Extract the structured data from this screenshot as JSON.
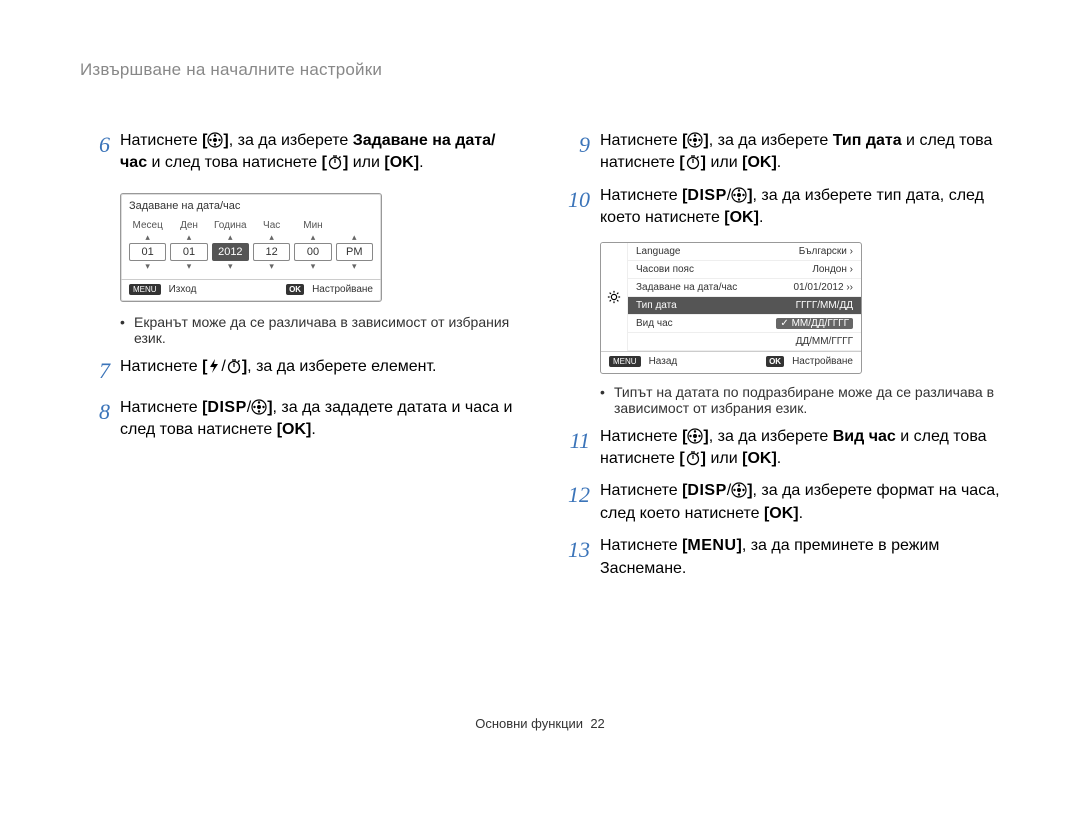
{
  "header": {
    "title": "Извършване на началните настройки"
  },
  "footer": {
    "section": "Основни функции",
    "page": "22"
  },
  "inline": {
    "ok": "OK",
    "disp": "DISP",
    "menu": "MENU",
    "bl": "[",
    "br": "]"
  },
  "left": {
    "steps": [
      {
        "num": "6",
        "pre": "Натиснете ",
        "mid1": ", за да изберете ",
        "bold": "Задаване на дата/час",
        "mid2": " и след това натиснете ",
        "mid3": " или ",
        "end": "."
      },
      {
        "num": "7",
        "pre": "Натиснете ",
        "mid": ", за да изберете елемент."
      },
      {
        "num": "8",
        "pre": "Натиснете ",
        "mid1": ", за да зададете датата и часа и след това натиснете ",
        "end": "."
      }
    ],
    "note": "Екранът може да се различава в зависимост от избрания език.",
    "screen": {
      "title": "Задаване на дата/час",
      "labels": [
        "Месец",
        "Ден",
        "Година",
        "Час",
        "Мин",
        ""
      ],
      "values": [
        "01",
        "01",
        "2012",
        "12",
        "00",
        "PM"
      ],
      "selectedIndex": 2,
      "exit": "Изход",
      "set": "Настройване",
      "menu_chip": "MENU",
      "ok_chip": "OK"
    }
  },
  "right": {
    "steps": [
      {
        "num": "9",
        "pre": "Натиснете ",
        "mid1": ", за да изберете ",
        "bold": "Тип дата",
        "mid2": " и след това натиснете ",
        "mid3": " или ",
        "end": "."
      },
      {
        "num": "10",
        "pre": "Натиснете ",
        "mid1": ", за да изберете тип дата, след което натиснете ",
        "end": "."
      },
      {
        "num": "11",
        "pre": "Натиснете ",
        "mid1": ", за да изберете ",
        "bold": "Вид час",
        "mid2": " и след това натиснете ",
        "mid3": " или ",
        "end": "."
      },
      {
        "num": "12",
        "pre": "Натиснете ",
        "mid1": ", за да изберете формат на часа, след което натиснете ",
        "end": "."
      },
      {
        "num": "13",
        "pre": "Натиснете ",
        "mid1": ", за да преминете в режим Заснемане."
      }
    ],
    "note": "Типът на датата по подразбиране може да се различава в зависимост от избрания език.",
    "screen": {
      "rows": [
        {
          "label": "Language",
          "value": "Български ›"
        },
        {
          "label": "Часови пояс",
          "value": "Лондон ›"
        },
        {
          "label": "Задаване на дата/час",
          "value": "01/01/2012 ››"
        }
      ],
      "highlight_label": "Тип дата",
      "opt1": "ГГГГ/ММ/ДД",
      "opt2": "ММ/ДД/ГГГГ",
      "opt3": "ДД/ММ/ГГГГ",
      "row5_label": "Вид час",
      "back": "Назад",
      "set": "Настройване",
      "menu_chip": "MENU",
      "ok_chip": "OK"
    }
  }
}
